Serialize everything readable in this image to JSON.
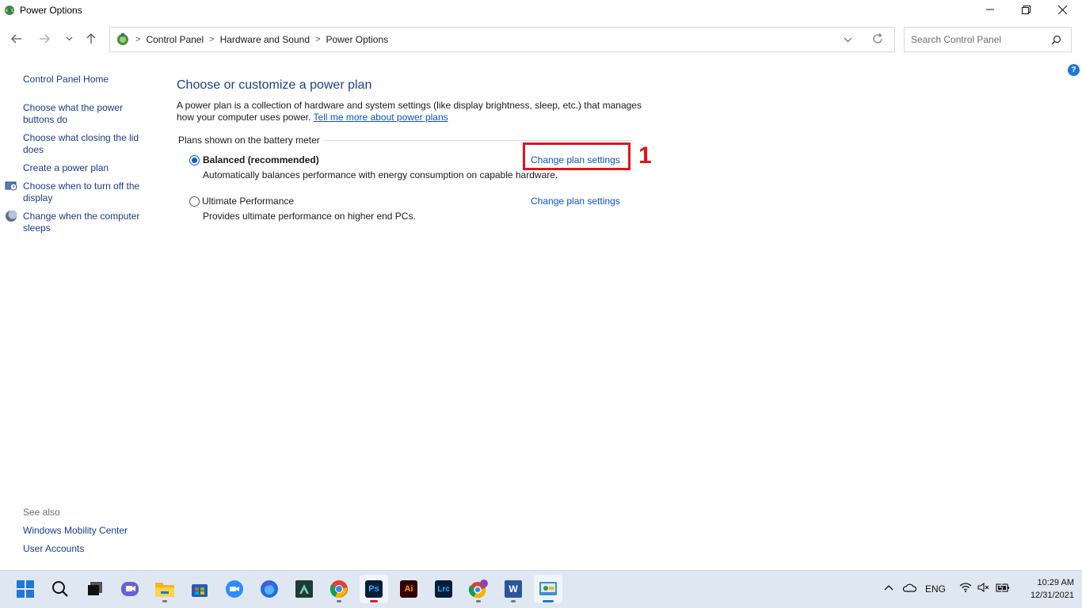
{
  "window": {
    "title": "Power Options"
  },
  "address": {
    "breadcrumbs": [
      "Control Panel",
      "Hardware and Sound",
      "Power Options"
    ]
  },
  "search": {
    "placeholder": "Search Control Panel"
  },
  "help_label": "?",
  "sidebar": {
    "home": "Control Panel Home",
    "items": [
      {
        "label": "Choose what the power buttons do",
        "icon": null
      },
      {
        "label": "Choose what closing the lid does",
        "icon": null
      },
      {
        "label": "Create a power plan",
        "icon": null
      },
      {
        "label": "Choose when to turn off the display",
        "icon": "display-clock-icon"
      },
      {
        "label": "Change when the computer sleeps",
        "icon": "moon-icon"
      }
    ],
    "see_also_label": "See also",
    "see_also": [
      "Windows Mobility Center",
      "User Accounts"
    ]
  },
  "main": {
    "heading": "Choose or customize a power plan",
    "description": "A power plan is a collection of hardware and system settings (like display brightness, sleep, etc.) that manages how your computer uses power.",
    "learn_more": "Tell me more about power plans",
    "group_label": "Plans shown on the battery meter",
    "plans": [
      {
        "name": "Balanced (recommended)",
        "description": "Automatically balances performance with energy consumption on capable hardware.",
        "link": "Change plan settings",
        "selected": true
      },
      {
        "name": "Ultimate Performance",
        "description": "Provides ultimate performance on higher end PCs.",
        "link": "Change plan settings",
        "selected": false
      }
    ],
    "annotation": "1"
  },
  "taskbar": {
    "apps": [
      "start-icon",
      "search-icon",
      "task-view-icon",
      "chat-icon",
      "file-explorer-icon",
      "store-icon",
      "zoom-icon",
      "firefox-icon",
      "app-icon",
      "chrome-icon",
      "photoshop-icon",
      "illustrator-icon",
      "lightroom-icon",
      "chrome-profile-icon",
      "word-icon",
      "control-panel-icon"
    ],
    "app_labels": {
      "photoshop": "Ps",
      "illustrator": "Ai",
      "lightroom": "Lrc",
      "word": "W"
    },
    "language": "ENG",
    "time": "10:29 AM",
    "date": "12/31/2021"
  },
  "colors": {
    "accent": "#0a5fc7",
    "link": "#0b54c2",
    "heading": "#1e3f8c",
    "annotation": "#e3131b",
    "taskbar": "#dfe7f2"
  }
}
